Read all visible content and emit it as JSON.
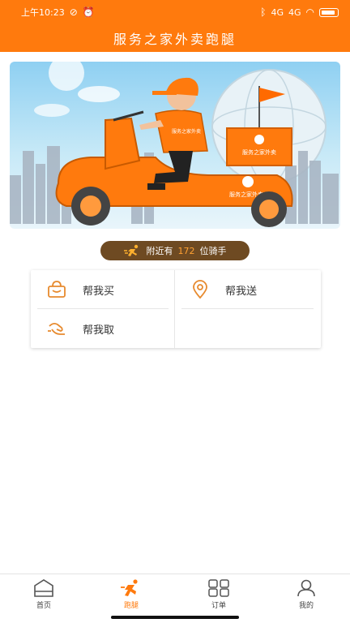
{
  "status_bar": {
    "time": "上午10:23",
    "signal_1": "4G",
    "signal_2": "4G",
    "battery": "100"
  },
  "header": {
    "title": "服务之家外卖跑腿"
  },
  "banner": {
    "box_text": "服务之家外卖",
    "shirt_text": "服务之家外卖",
    "scooter_text": "服务之家外卖"
  },
  "rider_info": {
    "prefix": "附近有",
    "count": "172",
    "suffix": "位骑手"
  },
  "services": [
    {
      "label": "帮我买",
      "icon": "shopping-bag-icon"
    },
    {
      "label": "帮我送",
      "icon": "location-pin-icon"
    },
    {
      "label": "帮我取",
      "icon": "pickup-hand-icon"
    }
  ],
  "nav": [
    {
      "label": "首页",
      "icon": "home-icon"
    },
    {
      "label": "跑腿",
      "icon": "running-icon"
    },
    {
      "label": "订单",
      "icon": "grid-icon"
    },
    {
      "label": "我的",
      "icon": "user-icon"
    }
  ],
  "colors": {
    "primary": "#ff7a0d",
    "pill_bg": "#6e4a22",
    "count": "#ffa133"
  }
}
